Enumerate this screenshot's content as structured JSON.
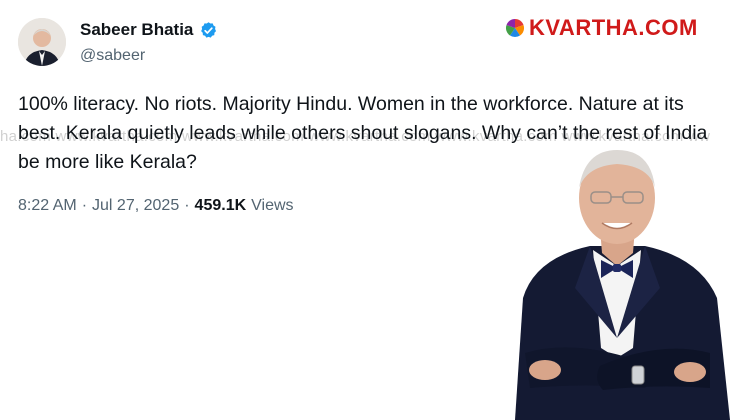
{
  "author": {
    "name": "Sabeer Bhatia",
    "handle": "@sabeer",
    "avatar_icon": "person-avatar-icon",
    "verified_icon": "verified-badge-icon"
  },
  "brand": {
    "logo_icon": "pinwheel-logo-icon",
    "name": "KVARTHA.COM",
    "name_color": "#d01a1a"
  },
  "tweet": {
    "text": "100% literacy. No riots. Majority Hindu. Women in the workforce. Nature at its best. Kerala quietly leads while others shout slogans. Why can’t the rest of India be more like Kerala?",
    "time": "8:22 AM",
    "separator": "·",
    "date": "Jul 27, 2025",
    "views_count": "459.1K",
    "views_label": "Views"
  },
  "watermark": {
    "text": "ha.com   www.kvartha.com   www.kvartha.com   www.kvartha.com   www.kvartha.com   www.kvartha.com   ww"
  },
  "colors": {
    "text_primary": "#0f1419",
    "text_secondary": "#536471",
    "verified_blue": "#1d9bf0"
  }
}
